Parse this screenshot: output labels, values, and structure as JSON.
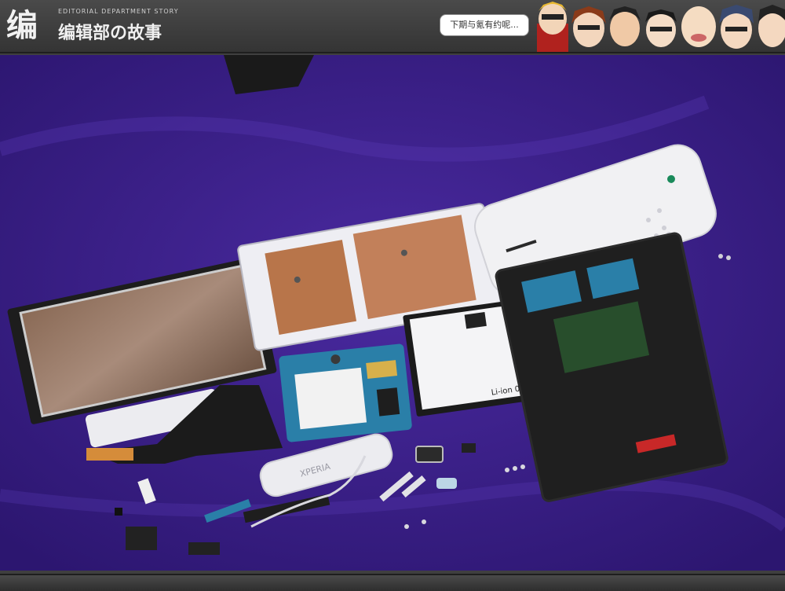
{
  "header": {
    "logo_glyph": "编",
    "logo_subtitle": "EDITORIAL DEPARTMENT STORY",
    "logo_title": "编辑部の故事",
    "speech_bubble": "下期与氪有约呢..."
  },
  "photo": {
    "back_cover_logo": "XPERIA",
    "battery_label": "Li-ion 00"
  },
  "colors": {
    "header_bg": "#3f3f3f",
    "fabric": "#3b1f86",
    "white_parts": "#e9e9ee",
    "copper": "#b8754a",
    "pcb_blue": "#2a7fa8",
    "black_parts": "#1f1f1f"
  }
}
